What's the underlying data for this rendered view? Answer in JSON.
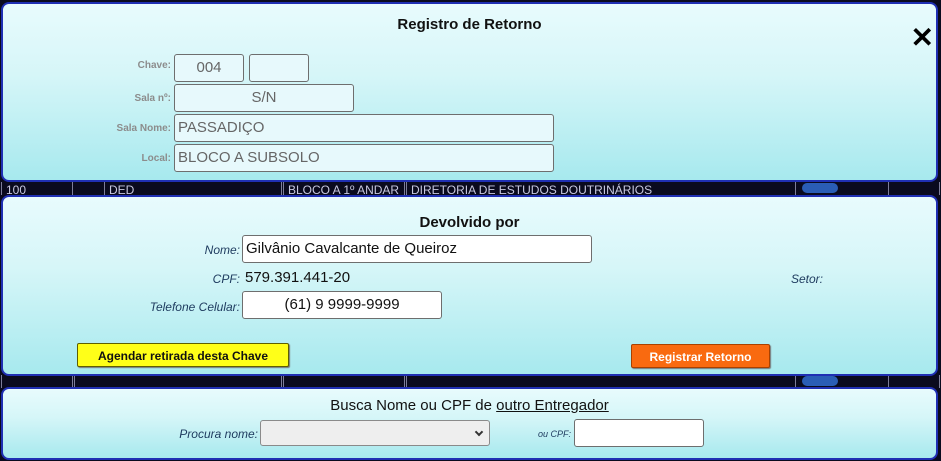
{
  "retorno": {
    "title": "Registro de Retorno",
    "close_glyph": "✕",
    "chave_label": "Chave:",
    "chave_value": "004",
    "chave_extra": "",
    "sala_label": "Sala nº:",
    "sala_value": "S/N",
    "sala_nome_label": "Sala Nome:",
    "sala_nome_value": "PASSADIÇO",
    "local_label": "Local:",
    "local_value": "BLOCO A SUBSOLO"
  },
  "background_row": {
    "cells": [
      "100",
      "DED",
      "BLOCO A 1º ANDAR",
      "DIRETORIA DE ESTUDOS DOUTRINÁRIOS"
    ]
  },
  "devolvido": {
    "title": "Devolvido por",
    "nome_label": "Nome:",
    "nome_value": "Gilvânio Cavalcante de Queiroz",
    "cpf_label": "CPF:",
    "cpf_value": "579.391.441-20",
    "setor_label": "Setor:",
    "telefone_label": "Telefone Celular:",
    "telefone_value": "(61) 9 9999-9999",
    "agendar_label": "Agendar retirada desta Chave",
    "registrar_label": "Registrar Retorno"
  },
  "busca": {
    "title_prefix": "Busca Nome ou CPF de ",
    "title_link": "outro Entregador",
    "procura_label": "Procura nome:",
    "procura_value": "",
    "cpf_label": "ou CPF:",
    "cpf_value": ""
  },
  "colors": {
    "panel_border": "#1f2fb3",
    "agendar_button": "#ffff18",
    "registrar_button": "#f96a10"
  }
}
